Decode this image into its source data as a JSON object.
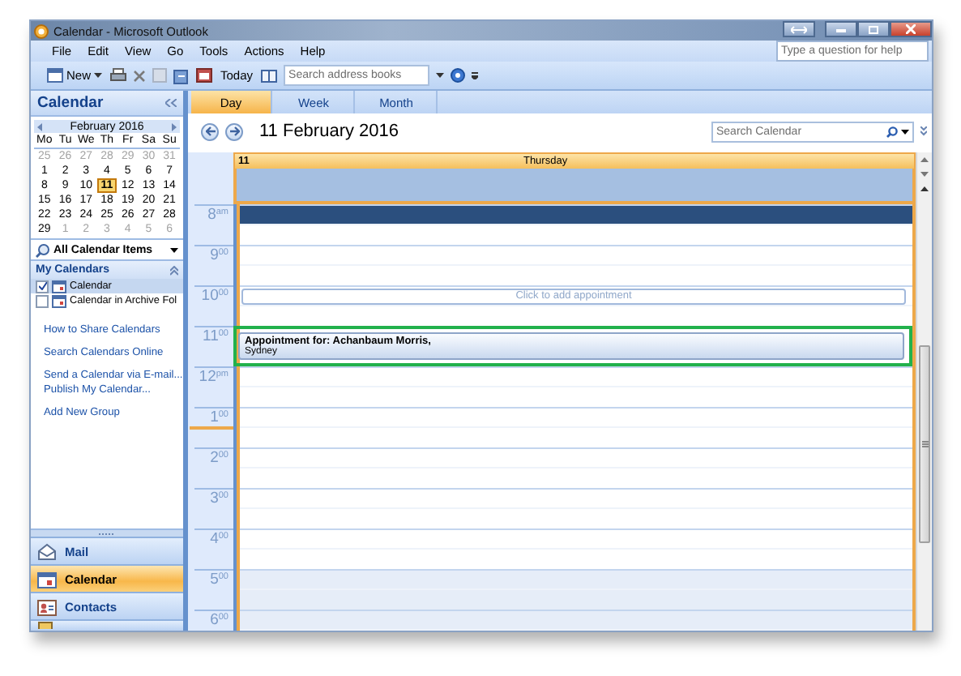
{
  "window": {
    "title": "Calendar - Microsoft Outlook"
  },
  "menu": [
    {
      "label": "File"
    },
    {
      "label": "Edit"
    },
    {
      "label": "View"
    },
    {
      "label": "Go"
    },
    {
      "label": "Tools"
    },
    {
      "label": "Actions"
    },
    {
      "label": "Help"
    }
  ],
  "help_search": {
    "placeholder": "Type a question for help"
  },
  "toolbar": {
    "new_label": "New",
    "today_label": "Today",
    "address_search": {
      "placeholder": "Search address books"
    }
  },
  "navigation_pane": {
    "title": "Calendar",
    "mini_calendar": {
      "month": "February 2016",
      "weekdays": [
        "Mo",
        "Tu",
        "We",
        "Th",
        "Fr",
        "Sa",
        "Su"
      ],
      "weeks": [
        [
          {
            "day": "25",
            "other_month": true,
            "selected": false
          },
          {
            "day": "26",
            "other_month": true,
            "selected": false
          },
          {
            "day": "27",
            "other_month": true,
            "selected": false
          },
          {
            "day": "28",
            "other_month": true,
            "selected": false
          },
          {
            "day": "29",
            "other_month": true,
            "selected": false
          },
          {
            "day": "30",
            "other_month": true,
            "selected": false
          },
          {
            "day": "31",
            "other_month": true,
            "selected": false
          }
        ],
        [
          {
            "day": "1",
            "other_month": false,
            "selected": false
          },
          {
            "day": "2",
            "other_month": false,
            "selected": false
          },
          {
            "day": "3",
            "other_month": false,
            "selected": false
          },
          {
            "day": "4",
            "other_month": false,
            "selected": false
          },
          {
            "day": "5",
            "other_month": false,
            "selected": false
          },
          {
            "day": "6",
            "other_month": false,
            "selected": false
          },
          {
            "day": "7",
            "other_month": false,
            "selected": false
          }
        ],
        [
          {
            "day": "8",
            "other_month": false,
            "selected": false
          },
          {
            "day": "9",
            "other_month": false,
            "selected": false
          },
          {
            "day": "10",
            "other_month": false,
            "selected": false
          },
          {
            "day": "11",
            "other_month": false,
            "selected": true
          },
          {
            "day": "12",
            "other_month": false,
            "selected": false
          },
          {
            "day": "13",
            "other_month": false,
            "selected": false
          },
          {
            "day": "14",
            "other_month": false,
            "selected": false
          }
        ],
        [
          {
            "day": "15",
            "other_month": false,
            "selected": false
          },
          {
            "day": "16",
            "other_month": false,
            "selected": false
          },
          {
            "day": "17",
            "other_month": false,
            "selected": false
          },
          {
            "day": "18",
            "other_month": false,
            "selected": false
          },
          {
            "day": "19",
            "other_month": false,
            "selected": false
          },
          {
            "day": "20",
            "other_month": false,
            "selected": false
          },
          {
            "day": "21",
            "other_month": false,
            "selected": false
          }
        ],
        [
          {
            "day": "22",
            "other_month": false,
            "selected": false
          },
          {
            "day": "23",
            "other_month": false,
            "selected": false
          },
          {
            "day": "24",
            "other_month": false,
            "selected": false
          },
          {
            "day": "25",
            "other_month": false,
            "selected": false
          },
          {
            "day": "26",
            "other_month": false,
            "selected": false
          },
          {
            "day": "27",
            "other_month": false,
            "selected": false
          },
          {
            "day": "28",
            "other_month": false,
            "selected": false
          }
        ],
        [
          {
            "day": "29",
            "other_month": false,
            "selected": false
          },
          {
            "day": "1",
            "other_month": true,
            "selected": false
          },
          {
            "day": "2",
            "other_month": true,
            "selected": false
          },
          {
            "day": "3",
            "other_month": true,
            "selected": false
          },
          {
            "day": "4",
            "other_month": true,
            "selected": false
          },
          {
            "day": "5",
            "other_month": true,
            "selected": false
          },
          {
            "day": "6",
            "other_month": true,
            "selected": false
          }
        ]
      ]
    },
    "view_filter": "All Calendar Items",
    "group": {
      "title": "My Calendars",
      "calendars": [
        {
          "name": "Calendar",
          "checked": true,
          "selected": true
        },
        {
          "name": "Calendar in Archive Fol",
          "checked": false,
          "selected": false
        }
      ]
    },
    "link_groups": [
      [
        "How to Share Calendars"
      ],
      [
        "Search Calendars Online"
      ],
      [
        "Send a Calendar via E-mail...",
        "Publish My Calendar..."
      ],
      [
        "Add New Group"
      ]
    ],
    "buttons": [
      {
        "label": "Mail",
        "selected": false
      },
      {
        "label": "Calendar",
        "selected": true
      },
      {
        "label": "Contacts",
        "selected": false
      }
    ]
  },
  "calendar_view": {
    "tabs": [
      {
        "label": "Day",
        "selected": true
      },
      {
        "label": "Week",
        "selected": false
      },
      {
        "label": "Month",
        "selected": false
      }
    ],
    "date_title": "11 February 2016",
    "search": {
      "placeholder": "Search Calendar"
    },
    "day_header": {
      "day_number": "11",
      "weekday": "Thursday"
    },
    "hours": [
      {
        "label": "8$^{am}$",
        "off_hours": false,
        "first_half_selected": true,
        "current_time": false
      },
      {
        "label": "9$^{00}$",
        "off_hours": false,
        "first_half_selected": false,
        "current_time": false
      },
      {
        "label": "10$^{00}$",
        "off_hours": false,
        "first_half_selected": false,
        "current_time": false,
        "item": {
          "kind": "placeholder",
          "text": "Click to add appointment"
        }
      },
      {
        "label": "11$^{00}$",
        "off_hours": false,
        "first_half_selected": false,
        "current_time": false,
        "item": {
          "kind": "appointment",
          "title": "Appointment for: Achanbaum Morris,",
          "location": "Sydney",
          "highlighted": true
        }
      },
      {
        "label": "12$^{pm}$",
        "off_hours": false,
        "first_half_selected": false,
        "current_time": false
      },
      {
        "label": "1$^{00}$",
        "off_hours": false,
        "first_half_selected": false,
        "current_time": true
      },
      {
        "label": "2$^{00}$",
        "off_hours": false,
        "first_half_selected": false,
        "current_time": false
      },
      {
        "label": "3$^{00}$",
        "off_hours": false,
        "first_half_selected": false,
        "current_time": false
      },
      {
        "label": "4$^{00}$",
        "off_hours": false,
        "first_half_selected": false,
        "current_time": false
      },
      {
        "label": "5$^{00}$",
        "off_hours": true,
        "first_half_selected": false,
        "current_time": false
      },
      {
        "label": "6$^{00}$",
        "off_hours": true,
        "first_half_selected": false,
        "current_time": false
      }
    ]
  }
}
